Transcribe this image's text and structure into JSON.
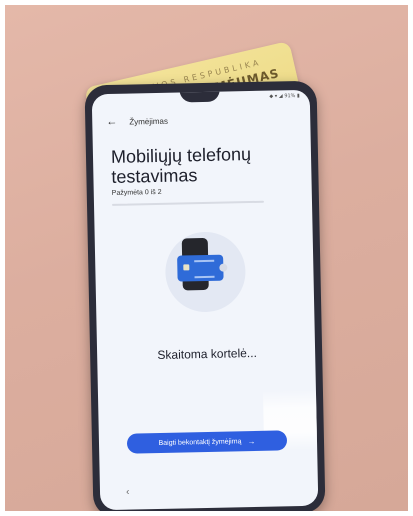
{
  "id_card": {
    "republic_text": "LIETUVOS RESPUBLIKA",
    "card_title": "ŽYMĖJIMAS"
  },
  "status_bar": {
    "indicators": "◆ ▾ ◢ 91% ▮"
  },
  "app_bar": {
    "back_icon": "arrow-left-icon",
    "title": "Žymėjimas"
  },
  "main": {
    "headline": "Mobiliųjų telefonų testavimas",
    "progress_label": "Pažymėta 0 iš 2",
    "illustration": "phone-scanning-card",
    "reading_status": "Skaitoma kortelė..."
  },
  "action": {
    "button_label": "Baigti bekontaktį žymėjimą",
    "button_icon": "arrow-right-icon"
  },
  "navigation": {
    "back_icon": "chevron-left-icon"
  },
  "colors": {
    "accent": "#2f5fe0",
    "card_blue": "#2f6bd8",
    "id_card_yellow": "#f3e39a"
  }
}
